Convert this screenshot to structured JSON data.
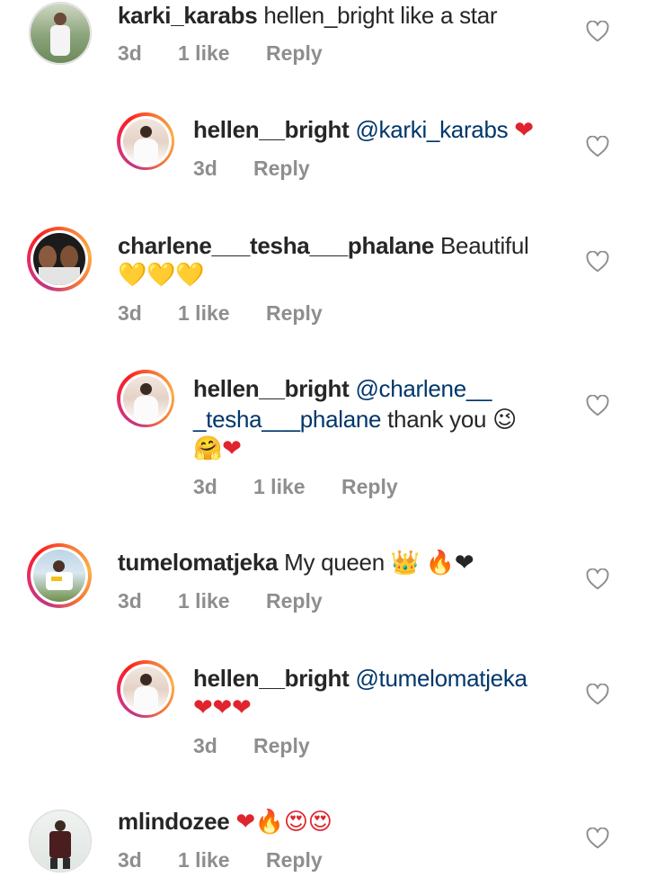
{
  "comments": [
    {
      "username": "karki_karabs",
      "text": " hellen_bright like a star",
      "time": "3d",
      "likes": "1 like",
      "reply": "Reply",
      "avatar_style": "plain"
    },
    {
      "username": "hellen__bright",
      "mention": "@karki_karabs",
      "emoji": "❤",
      "time": "3d",
      "reply": "Reply",
      "avatar_style": "ring"
    },
    {
      "username": "charlene___tesha___phalane",
      "text": " Beautiful",
      "emoji_line": "💛💛💛",
      "time": "3d",
      "likes": "1 like",
      "reply": "Reply",
      "avatar_style": "ring"
    },
    {
      "username": "hellen__bright",
      "mention_line1": "@charlene__",
      "mention_line2": "_tesha___phalane",
      "text": " thank you 😉",
      "emoji_line": "🤗❤",
      "time": "3d",
      "likes": "1 like",
      "reply": "Reply",
      "avatar_style": "ring"
    },
    {
      "username": "tumelomatjeka",
      "text": " My queen 👑 🔥❤",
      "time": "3d",
      "likes": "1 like",
      "reply": "Reply",
      "avatar_style": "ring"
    },
    {
      "username": "hellen__bright",
      "mention": "@tumelomatjeka",
      "emoji_line": "❤❤❤",
      "time": "3d",
      "reply": "Reply",
      "avatar_style": "ring"
    },
    {
      "username": "mlindozee",
      "text": " ❤🔥😍😍",
      "time": "3d",
      "likes": "1 like",
      "reply": "Reply",
      "avatar_style": "plain"
    }
  ],
  "colors": {
    "text": "#262626",
    "meta": "#8e8e8e",
    "mention": "#00376b",
    "heart_emoji": "#e0242e"
  },
  "icons": {
    "like": "heart-outline-icon"
  }
}
